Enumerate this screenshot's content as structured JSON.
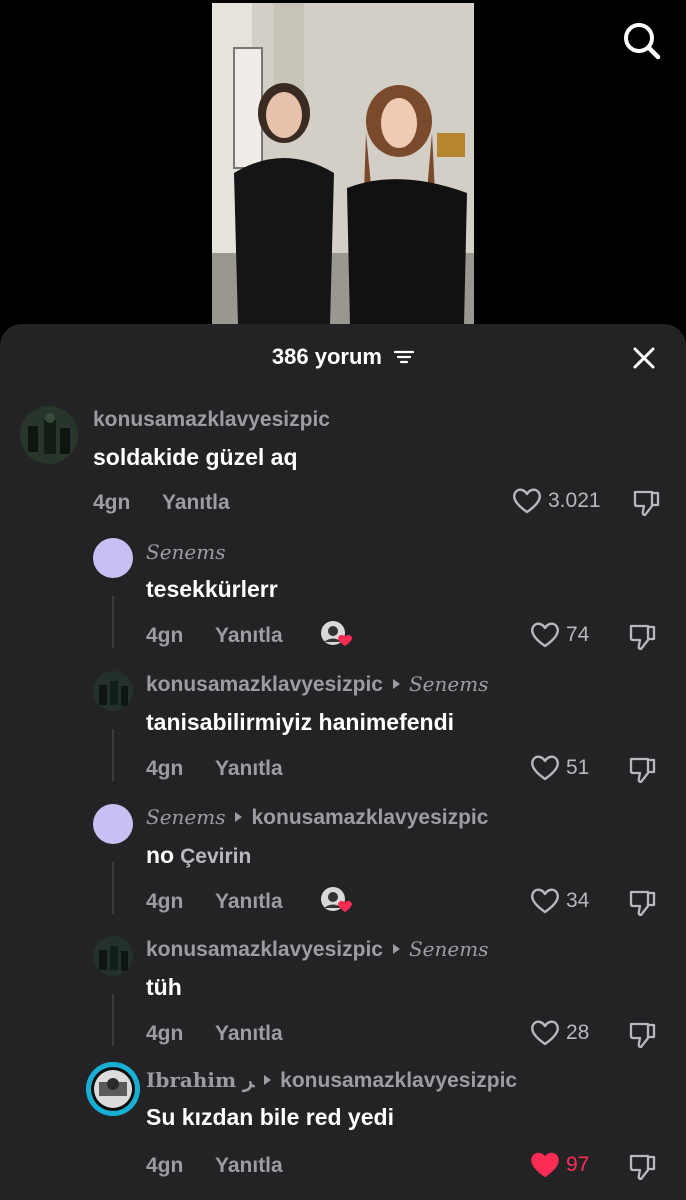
{
  "sheet": {
    "count_label": "386 yorum"
  },
  "comments": [
    {
      "user": "konusamazklavyesizpic",
      "text": "soldakide güzel aq",
      "time": "4gn",
      "reply": "Yanıtla",
      "likes": "3.021"
    },
    {
      "user": "Senems",
      "text": "tesekkürlerr",
      "time": "4gn",
      "reply": "Yanıtla",
      "likes": "74"
    },
    {
      "user": "konusamazklavyesizpic",
      "reply_to": "Senems",
      "text": "tanisabilirmiyiz hanimefendi",
      "time": "4gn",
      "reply": "Yanıtla",
      "likes": "51"
    },
    {
      "user": "Senems",
      "reply_to": "konusamazklavyesizpic",
      "text": "no",
      "translate": "Çevirin",
      "time": "4gn",
      "reply": "Yanıtla",
      "likes": "34"
    },
    {
      "user": "konusamazklavyesizpic",
      "reply_to": "Senems",
      "text": "tüh",
      "time": "4gn",
      "reply": "Yanıtla",
      "likes": "28"
    },
    {
      "user": "Ibrahim ﺮ",
      "reply_to": "konusamazklavyesizpic",
      "text": "Su kızdan bile red yedi",
      "time": "4gn",
      "reply": "Yanıtla",
      "likes": "97"
    }
  ],
  "colors": {
    "sheet_bg": "#232325",
    "liked_red": "#fe2c55",
    "avatar_lavender": "#c8bff2"
  },
  "icons": [
    "search-icon",
    "sort-icon",
    "close-icon",
    "heart-icon",
    "dislike-icon",
    "creator-liked-icon"
  ]
}
